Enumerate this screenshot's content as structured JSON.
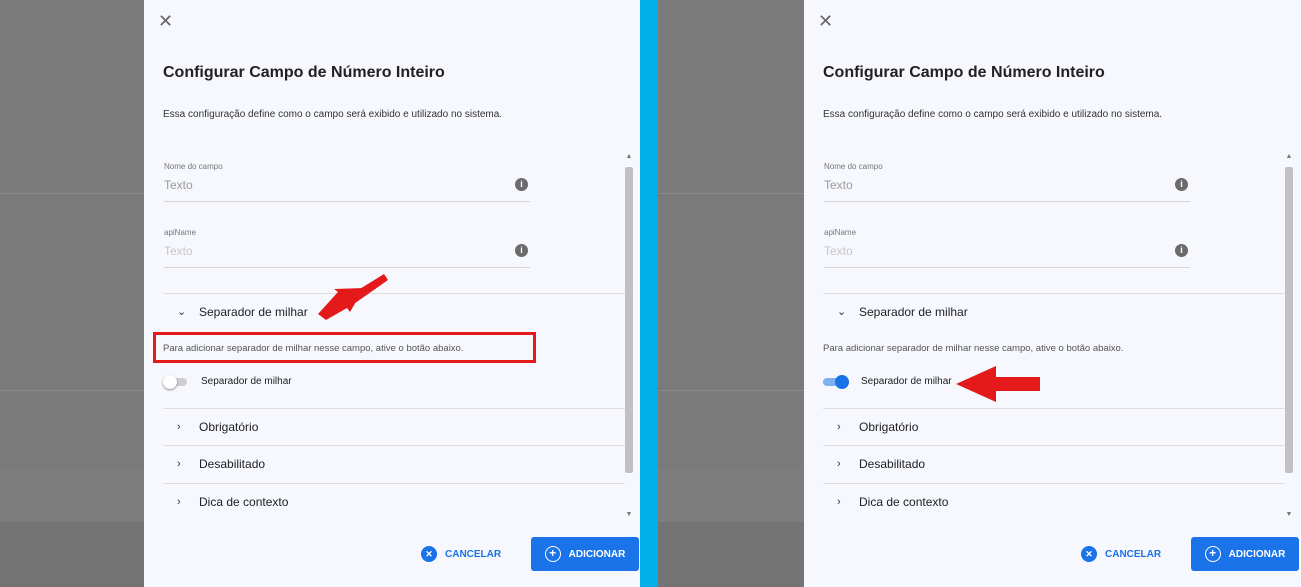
{
  "panels": [
    {
      "close_glyph": "✕",
      "title": "Configurar Campo de Número Inteiro",
      "description": "Essa configuração define como o campo será exibido e utilizado no sistema.",
      "fields": [
        {
          "label": "Nome do campo",
          "placeholder": "Texto",
          "info_glyph": "i"
        },
        {
          "label": "apiName",
          "placeholder": "Texto",
          "info_glyph": "i"
        }
      ],
      "thousand_separator": {
        "chevron": "⌄",
        "label": "Separador de milhar",
        "helper": "Para adicionar separador de milhar nesse campo, ative o botão abaixo.",
        "toggle_label": "Separador de milhar",
        "toggle_state": "off"
      },
      "sections": [
        {
          "chevron": "›",
          "label": "Obrigatório"
        },
        {
          "chevron": "›",
          "label": "Desabilitado"
        },
        {
          "chevron": "›",
          "label": "Dica de contexto"
        }
      ],
      "actions": {
        "cancel_label": "CANCELAR",
        "add_label": "ADICIONAR",
        "cancel_glyph": "✕",
        "add_glyph": "+"
      },
      "scroll_glyphs": {
        "up": "▲",
        "down": "▼"
      }
    },
    {
      "close_glyph": "✕",
      "title": "Configurar Campo de Número Inteiro",
      "description": "Essa configuração define como o campo será exibido e utilizado no sistema.",
      "fields": [
        {
          "label": "Nome do campo",
          "placeholder": "Texto",
          "info_glyph": "i"
        },
        {
          "label": "apiName",
          "placeholder": "Texto",
          "info_glyph": "i"
        }
      ],
      "thousand_separator": {
        "chevron": "⌄",
        "label": "Separador de milhar",
        "helper": "Para adicionar separador de milhar nesse campo, ative o botão abaixo.",
        "toggle_label": "Separador de milhar",
        "toggle_state": "on"
      },
      "sections": [
        {
          "chevron": "›",
          "label": "Obrigatório"
        },
        {
          "chevron": "›",
          "label": "Desabilitado"
        },
        {
          "chevron": "›",
          "label": "Dica de contexto"
        }
      ],
      "actions": {
        "cancel_label": "CANCELAR",
        "add_label": "ADICIONAR",
        "cancel_glyph": "✕",
        "add_glyph": "+"
      },
      "scroll_glyphs": {
        "up": "▲",
        "down": "▼"
      }
    }
  ],
  "colors": {
    "accent": "#1a73e8",
    "annotation_red": "#e41919",
    "divider": "#00aee8",
    "panel_bg": "#f6f8fe",
    "backdrop": "#7a7a7a"
  },
  "icons": [
    "close-icon",
    "info-icon",
    "chevron-down-icon",
    "chevron-right-icon",
    "cancel-circle-icon",
    "add-circle-icon",
    "annotation-arrow-icon"
  ]
}
